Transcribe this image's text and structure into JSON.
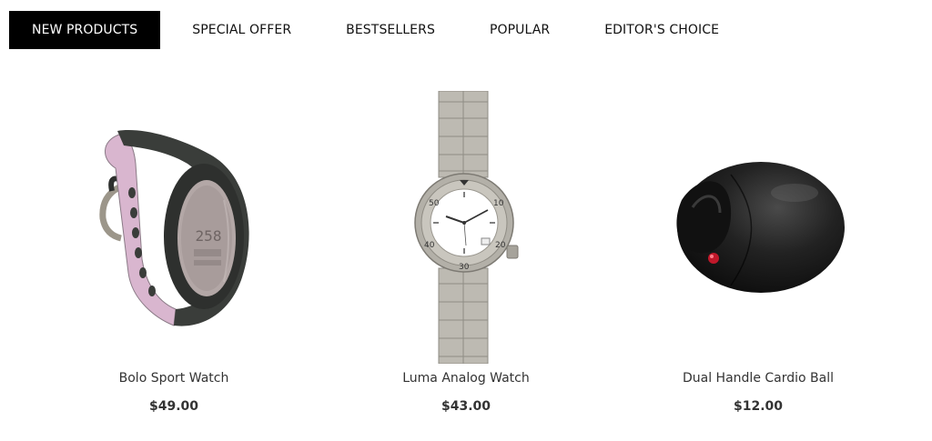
{
  "tabs": [
    {
      "label": "NEW PRODUCTS",
      "active": true
    },
    {
      "label": "SPECIAL OFFER",
      "active": false
    },
    {
      "label": "BESTSELLERS",
      "active": false
    },
    {
      "label": "POPULAR",
      "active": false
    },
    {
      "label": "EDITOR'S CHOICE",
      "active": false
    }
  ],
  "products": [
    {
      "name": "Bolo Sport Watch",
      "price": "$49.00",
      "image": "digital-sport-watch-icon",
      "display": "258"
    },
    {
      "name": "Luma Analog Watch",
      "price": "$43.00",
      "image": "analog-watch-icon",
      "bezel": [
        "50",
        "10",
        "40",
        "20",
        "30"
      ]
    },
    {
      "name": "Dual Handle Cardio Ball",
      "price": "$12.00",
      "image": "cardio-ball-icon"
    }
  ],
  "colors": {
    "active_tab_bg": "#000000",
    "active_tab_text": "#ffffff",
    "text": "#333333",
    "strap_pink": "#d9b6cf",
    "watch_dark": "#3a3d3a",
    "steel": "#b9b6ad",
    "ball_black": "#1c1c1c",
    "accent_red": "#c0182a"
  }
}
